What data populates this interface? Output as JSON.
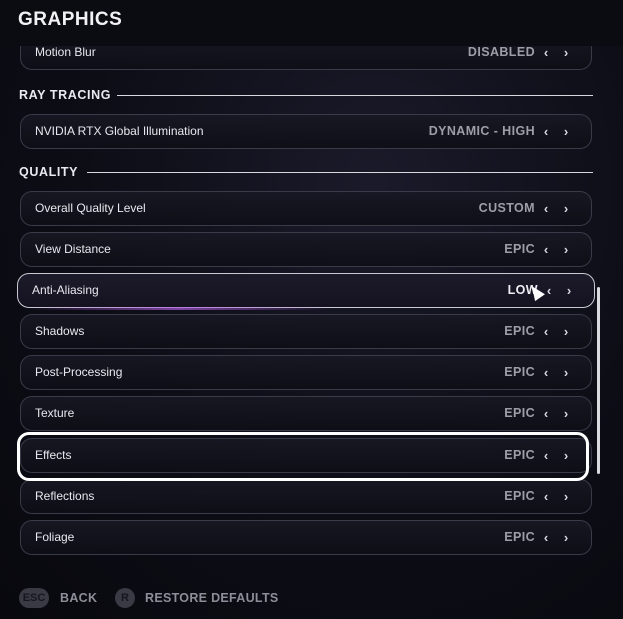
{
  "header": {
    "title": "GRAPHICS"
  },
  "rows_top": [
    {
      "label": "Motion Blur",
      "value": "DISABLED"
    }
  ],
  "sections": {
    "ray_tracing": "RAY TRACING",
    "quality": "QUALITY"
  },
  "ray_tracing_rows": [
    {
      "label": "NVIDIA RTX Global Illumination",
      "value": "DYNAMIC - HIGH"
    }
  ],
  "quality_rows": [
    {
      "label": "Overall Quality Level",
      "value": "CUSTOM"
    },
    {
      "label": "View Distance",
      "value": "EPIC"
    },
    {
      "label": "Anti-Aliasing",
      "value": "LOW",
      "state": "hovered"
    },
    {
      "label": "Shadows",
      "value": "EPIC"
    },
    {
      "label": "Post-Processing",
      "value": "EPIC"
    },
    {
      "label": "Texture",
      "value": "EPIC"
    },
    {
      "label": "Effects",
      "value": "EPIC",
      "state": "selected"
    },
    {
      "label": "Reflections",
      "value": "EPIC"
    },
    {
      "label": "Foliage",
      "value": "EPIC"
    }
  ],
  "arrows": {
    "left": "‹",
    "right": "›"
  },
  "footer": {
    "back_key": "ESC",
    "back_label": "BACK",
    "restore_key": "R",
    "restore_label": "RESTORE DEFAULTS"
  }
}
